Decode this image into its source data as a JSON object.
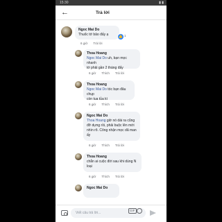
{
  "status": {
    "time": "15:30",
    "right": "▮ ▮"
  },
  "header": {
    "title": "Trả lời"
  },
  "comments": [
    {
      "name": "Ngoc Mai Do",
      "lines": [
        "Thuốc tớ bảo đấy ạ"
      ],
      "time": "6 giờ",
      "reply": "Trả lời",
      "reaction_count": "1"
    },
    {
      "name": "Thoa Hoang",
      "mention": "Ngoc Mai Do",
      "lines": [
        " uh, bạn mọc nhanh",
        "tớ phải gần 2 tháng đấy"
      ],
      "time": "6 giờ",
      "like": "Thích",
      "reply": "Trả lời"
    },
    {
      "name": "Thoa Hoang",
      "mention": "Ngoc Mai Do",
      "lines": [
        " tóc bạn đâu chụp",
        "còn tua tủa kì"
      ],
      "time": "6 giờ",
      "like": "Thích",
      "reply": "Trả lời"
    },
    {
      "name": "Ngoc Mai Do",
      "mention": "Thoa Hoang",
      "lines": [
        " giờ nó dài ra cũng",
        "đỡ dựng rồi, phải buộc lên mới",
        "nhìn rõ. Công nhận mọc dã man",
        "ấy"
      ],
      "time": "6 giờ",
      "like": "Thích",
      "reply": "Trả lời"
    },
    {
      "name": "Thoa Hoang",
      "lines": [
        "chắn ai cuộc đời sau khi dùng N",
        "loại"
      ],
      "time": "6 giờ",
      "like": "Thích",
      "reply": "Trả lời"
    },
    {
      "name": "Ngoc Mai Do",
      "lines": [],
      "time": "",
      "like": "",
      "reply": ""
    }
  ],
  "composer": {
    "placeholder": "Viết câu trả lời...",
    "gif": "GIF"
  }
}
